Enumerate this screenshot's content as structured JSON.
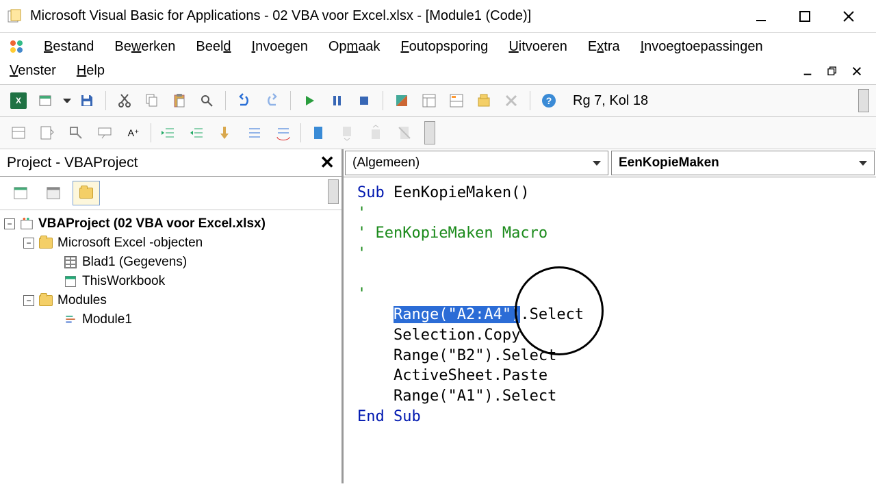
{
  "title": "Microsoft Visual Basic for Applications - 02 VBA voor Excel.xlsx - [Module1 (Code)]",
  "menu": {
    "bestand": "Bestand",
    "bewerken": "Bewerken",
    "beeld": "Beeld",
    "invoegen": "Invoegen",
    "opmaak": "Opmaak",
    "foutopsporing": "Foutopsporing",
    "uitvoeren": "Uitvoeren",
    "extra": "Extra",
    "invoegtoepassingen": "Invoegtoepassingen",
    "venster": "Venster",
    "help": "Help"
  },
  "cursor_pos": "Rg 7, Kol 18",
  "project": {
    "title": "Project - VBAProject",
    "root": "VBAProject (02 VBA voor Excel.xlsx)",
    "excel_objects": "Microsoft Excel -objecten",
    "sheet1": "Blad1 (Gegevens)",
    "workbook": "ThisWorkbook",
    "modules_folder": "Modules",
    "module1": "Module1"
  },
  "code_dropdowns": {
    "object": "(Algemeen)",
    "procedure": "EenKopieMaken"
  },
  "code": {
    "sub_kw": "Sub ",
    "sub_name": "EenKopieMaken()",
    "c1": "'",
    "c2": "' EenKopieMaken Macro",
    "c3": "'",
    "c4": "'",
    "l1_sel": "Range(\"A2:A4\")",
    "l1_rest": ".Select",
    "l2": "Selection.Copy",
    "l3": "Range(\"B2\").Select",
    "l4": "ActiveSheet.Paste",
    "l5": "Range(\"A1\").Select",
    "end_kw": "End Sub"
  }
}
